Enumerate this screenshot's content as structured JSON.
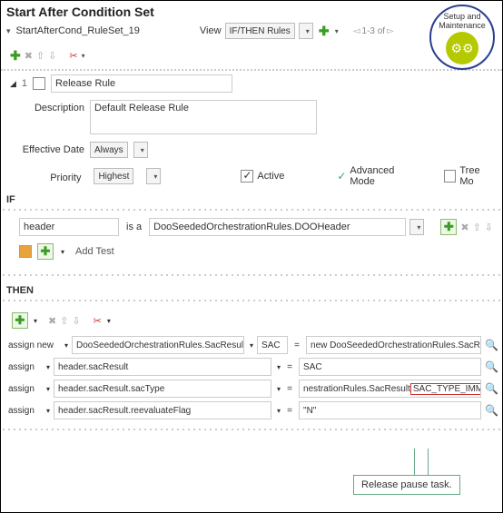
{
  "header": {
    "title": "Start After Condition Set",
    "ruleSetName": "StartAfterCond_RuleSet_19",
    "viewLabel": "View",
    "viewValue": "IF/THEN Rules",
    "pager": "1-3 of"
  },
  "badge": {
    "line1": "Setup and",
    "line2": "Maintenance"
  },
  "rule": {
    "name": "Release Rule",
    "descriptionLabel": "Description",
    "description": "Default Release Rule",
    "effectiveDateLabel": "Effective Date",
    "effectiveDate": "Always",
    "priorityLabel": "Priority",
    "priority": "Highest",
    "activeLabel": "Active",
    "advancedLabel": "Advanced Mode",
    "treeLabel": "Tree Mo"
  },
  "if": {
    "label": "IF",
    "subject": "header",
    "op": "is a",
    "type": "DooSeededOrchestrationRules.DOOHeader",
    "addTest": "Add Test"
  },
  "then": {
    "label": "THEN",
    "rows": [
      {
        "action": "assign new",
        "lhs": "DooSeededOrchestrationRules.SacResult",
        "mid": "SAC",
        "eq": "=",
        "rhs": "new DooSeededOrchestrationRules.SacResult()"
      },
      {
        "action": "assign",
        "lhs": "header.sacResult",
        "mid": "",
        "eq": "=",
        "rhs": "SAC"
      },
      {
        "action": "assign",
        "lhs": "header.sacResult.sacType",
        "mid": "",
        "eq": "=",
        "rhs": "nestrationRules.SacResult",
        "highlight": "SAC_TYPE_IMMEDIATE"
      },
      {
        "action": "assign",
        "lhs": "header.sacResult.reevaluateFlag",
        "mid": "",
        "eq": "=",
        "rhs": "\"N\""
      }
    ]
  },
  "callout": "Release pause task."
}
